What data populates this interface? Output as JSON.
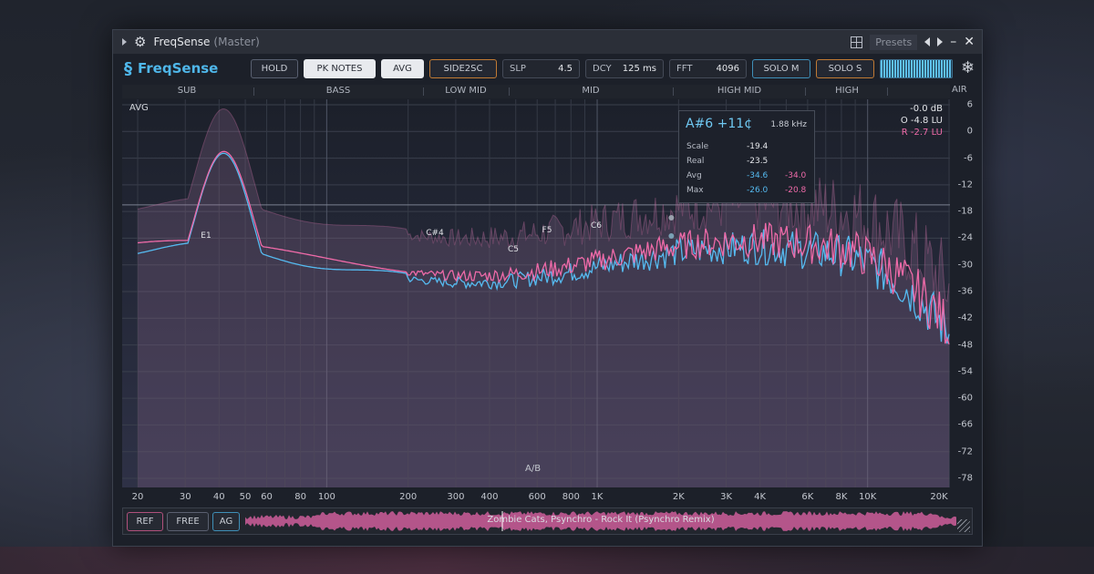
{
  "titlebar": {
    "title": "FreqSense",
    "subtitle": "(Master)",
    "presets_label": "Presets"
  },
  "logo": {
    "name": "FreqSense"
  },
  "toolbar": {
    "hold": "HOLD",
    "pk_notes": "PK NOTES",
    "avg": "AVG",
    "side2sc": "SIDE2SC",
    "slp_label": "SLP",
    "slp_value": "4.5",
    "dcy_label": "DCY",
    "dcy_value": "125 ms",
    "fft_label": "FFT",
    "fft_value": "4096",
    "solo_m": "SOLO M",
    "solo_s": "SOLO S"
  },
  "bands": [
    "SUB",
    "BASS",
    "LOW MID",
    "MID",
    "HIGH MID",
    "HIGH",
    "AIR"
  ],
  "plot": {
    "mode_label": "AVG",
    "ab_label": "A/B",
    "levels": {
      "peak": "-0.0 dB",
      "overall": "O -4.8 LU",
      "relative": "R -2.7 LU"
    },
    "notes": [
      "E1",
      "C#4",
      "C5",
      "F5",
      "C6"
    ]
  },
  "tooltip": {
    "note": "A#6 +11¢",
    "freq": "1.88 kHz",
    "scale_label": "Scale",
    "scale_value": "-19.4",
    "real_label": "Real",
    "real_value": "-23.5",
    "avg_label": "Avg",
    "avg_a": "-34.6",
    "avg_b": "-34.0",
    "max_label": "Max",
    "max_a": "-26.0",
    "max_b": "-20.8"
  },
  "y_ticks": [
    "6",
    "0",
    "-6",
    "-12",
    "-18",
    "-24",
    "-30",
    "-36",
    "-42",
    "-48",
    "-54",
    "-60",
    "-66",
    "-72",
    "-78"
  ],
  "x_ticks": [
    "20",
    "30",
    "40",
    "50",
    "60",
    "80",
    "100",
    "200",
    "300",
    "400",
    "600",
    "800",
    "1K",
    "2K",
    "3K",
    "4K",
    "6K",
    "8K",
    "10K",
    "20K"
  ],
  "bottom": {
    "ref": "REF",
    "free": "FREE",
    "ag": "AG",
    "track": "Zombie Cats, Psynchro - Rock It (Psynchro Remix)"
  },
  "colors": {
    "accent_blue": "#55baf0",
    "accent_pink": "#ee6aa8",
    "orange": "#c07a34"
  }
}
